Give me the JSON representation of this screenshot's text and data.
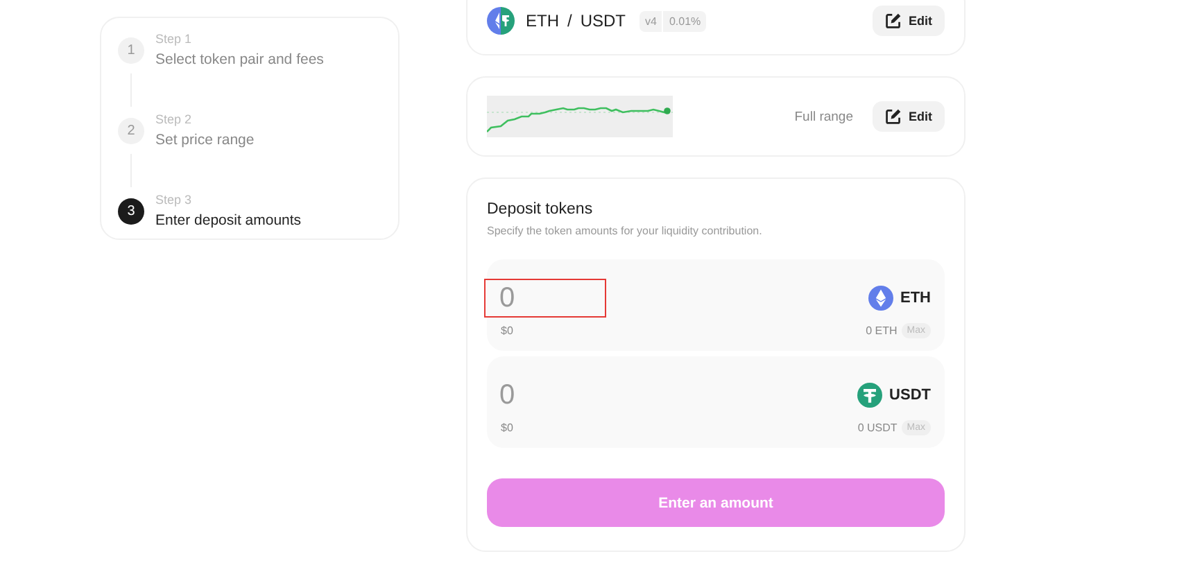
{
  "steps": [
    {
      "number": "1",
      "label": "Step 1",
      "title": "Select token pair and fees",
      "active": false
    },
    {
      "number": "2",
      "label": "Step 2",
      "title": "Set price range",
      "active": false
    },
    {
      "number": "3",
      "label": "Step 3",
      "title": "Enter deposit amounts",
      "active": true
    }
  ],
  "pair": {
    "base": "ETH",
    "separator": "/",
    "quote": "USDT",
    "version": "v4",
    "fee": "0.01%",
    "edit": "Edit"
  },
  "range": {
    "label": "Full range",
    "edit": "Edit"
  },
  "deposit": {
    "title": "Deposit tokens",
    "subtitle": "Specify the token amounts for your liquidity contribution.",
    "tokens": [
      {
        "amount": "0",
        "usd": "$0",
        "symbol": "ETH",
        "kind": "eth",
        "balance": "0 ETH",
        "max": "Max",
        "highlighted": true
      },
      {
        "amount": "0",
        "usd": "$0",
        "symbol": "USDT",
        "kind": "usdt",
        "balance": "0 USDT",
        "max": "Max",
        "highlighted": false
      }
    ],
    "submit": {
      "label": "Enter an amount",
      "disabled": true
    }
  }
}
